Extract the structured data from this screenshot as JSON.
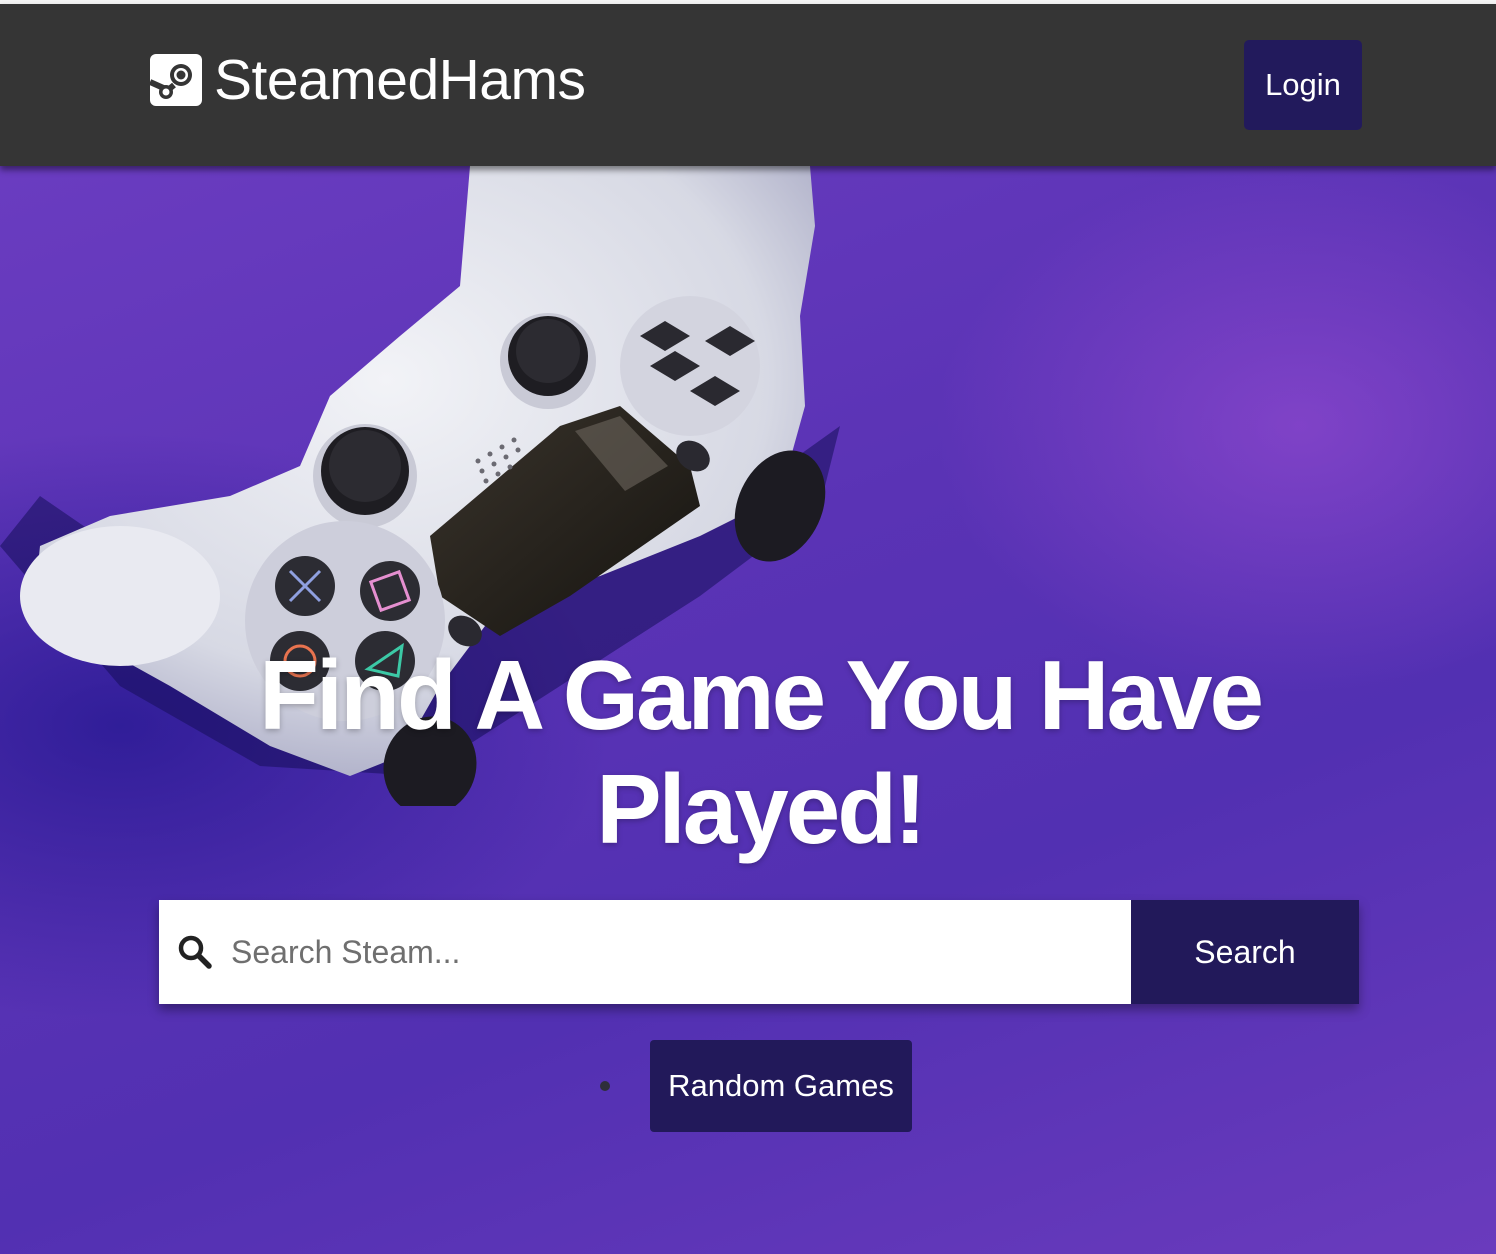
{
  "header": {
    "brand_name": "SteamedHams",
    "brand_icon": "steam-logo-icon",
    "login_label": "Login"
  },
  "hero": {
    "headline": "Find A Game You Have Played!",
    "background_image": "game-controller-photo",
    "search": {
      "placeholder": "Search Steam...",
      "value": "",
      "icon": "search-icon",
      "button_label": "Search"
    },
    "random_games_label": "Random Games"
  },
  "colors": {
    "navbar": "#353535",
    "button": "#22195a",
    "hero_purple": "#5a33b5",
    "text_light": "#ffffff"
  }
}
